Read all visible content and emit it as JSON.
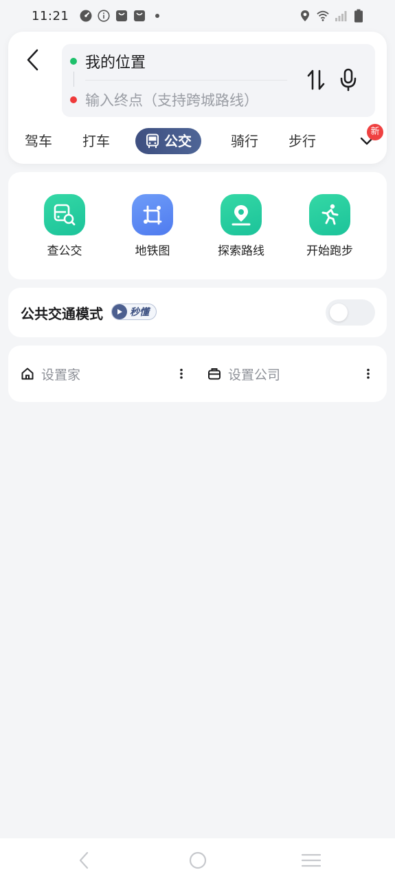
{
  "status_bar": {
    "time": "11:21",
    "left_icons": [
      "speedometer-icon",
      "info-icon",
      "shopping-bag-icon",
      "shopping-bag-icon",
      "dot-icon"
    ],
    "right_icons": [
      "location-icon",
      "wifi-icon",
      "signal-icon",
      "battery-icon"
    ]
  },
  "route": {
    "start": "我的位置",
    "end_placeholder": "输入终点（支持跨城路线）"
  },
  "mode_tabs": {
    "items": [
      "驾车",
      "打车",
      "公交",
      "骑行",
      "步行"
    ],
    "active": "公交",
    "new_badge": "新"
  },
  "quick_actions": [
    {
      "label": "查公交",
      "icon": "bus-search-icon"
    },
    {
      "label": "地铁图",
      "icon": "subway-map-icon"
    },
    {
      "label": "探索路线",
      "icon": "explore-route-icon"
    },
    {
      "label": "开始跑步",
      "icon": "running-icon"
    }
  ],
  "transit_mode": {
    "title": "公共交通模式",
    "badge": "秒懂",
    "toggle_on": false
  },
  "places": {
    "home": "设置家",
    "company": "设置公司"
  },
  "colors": {
    "accent": "#3e4f80",
    "green": "#1ec06b",
    "red": "#ef3a3a",
    "badge_red": "#ef4141"
  }
}
